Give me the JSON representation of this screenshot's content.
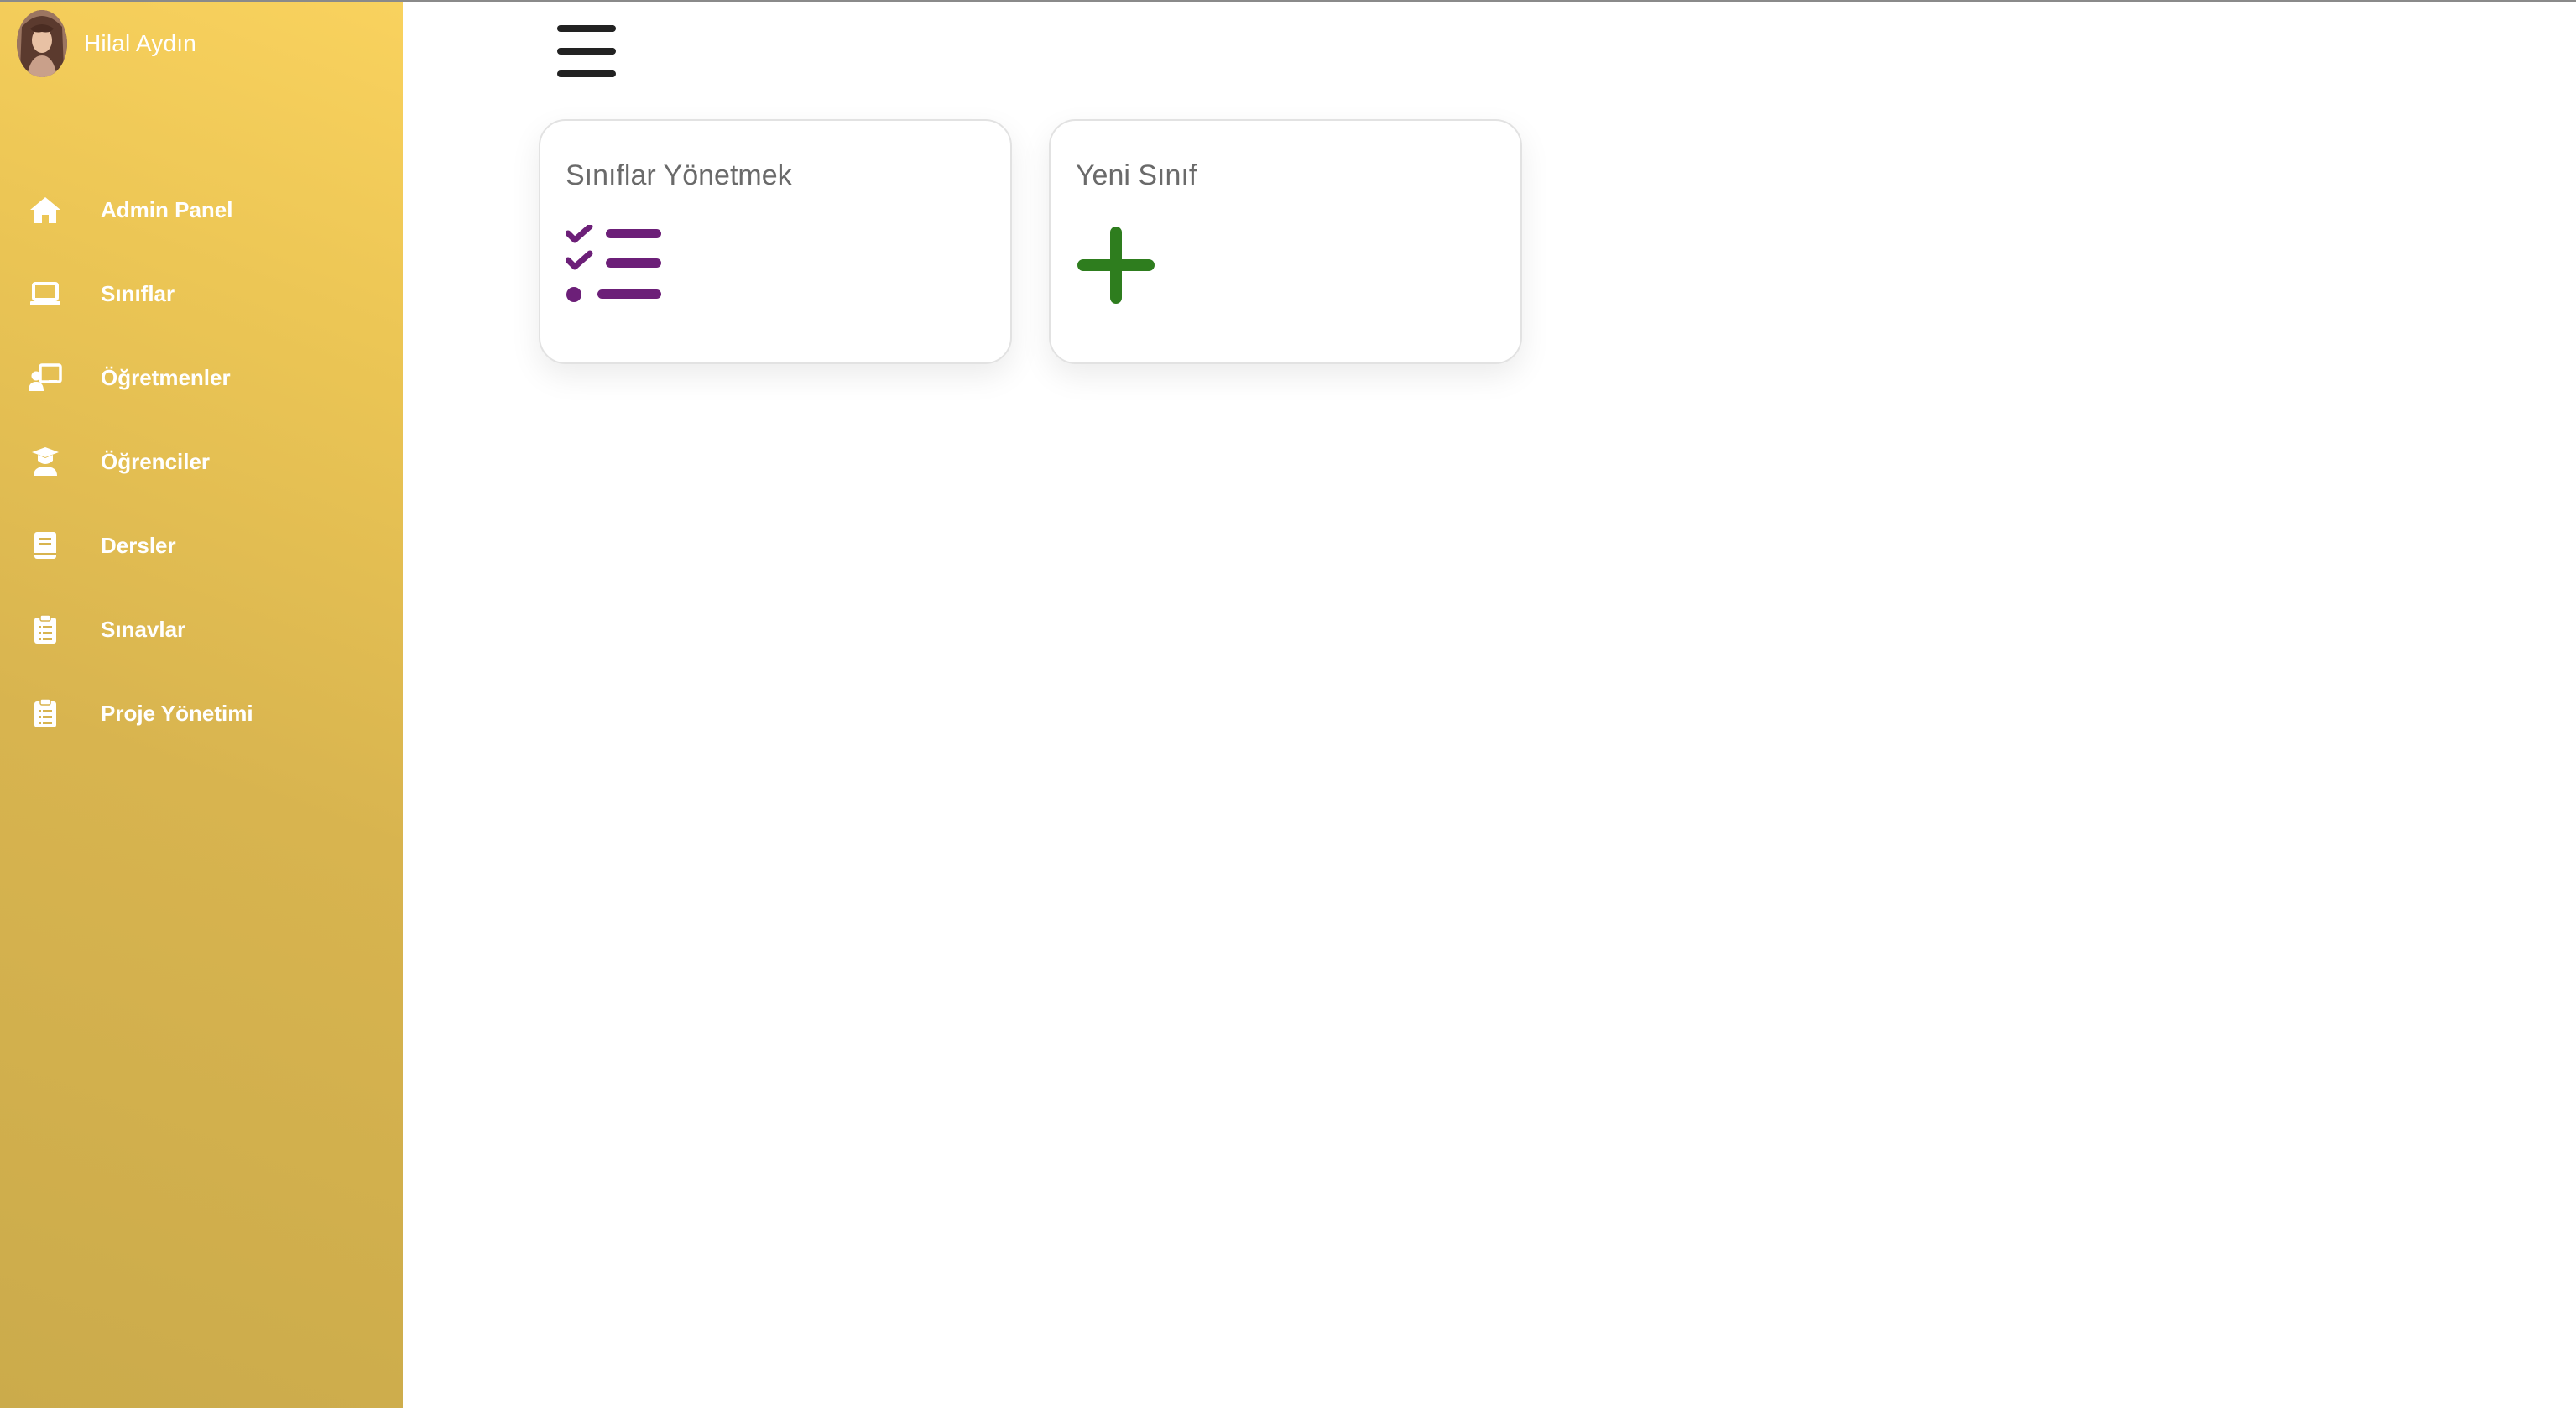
{
  "user": {
    "name": "Hilal Aydın"
  },
  "sidebar": {
    "items": [
      {
        "label": "Admin Panel",
        "icon": "home-icon"
      },
      {
        "label": "Sınıflar",
        "icon": "laptop-icon"
      },
      {
        "label": "Öğretmenler",
        "icon": "teacher-board-icon"
      },
      {
        "label": "Öğrenciler",
        "icon": "graduate-icon"
      },
      {
        "label": "Dersler",
        "icon": "book-icon"
      },
      {
        "label": "Sınavlar",
        "icon": "clipboard-icon"
      },
      {
        "label": "Proje Yönetimi",
        "icon": "clipboard-icon"
      }
    ]
  },
  "header": {
    "menu_icon": "hamburger-menu-icon"
  },
  "cards": [
    {
      "title": "Sınıflar Yönetmek",
      "icon": "checklist-icon",
      "icon_color": "#6c1f78"
    },
    {
      "title": "Yeni Sınıf",
      "icon": "plus-icon",
      "icon_color": "#2e7d1e"
    }
  ],
  "colors": {
    "sidebar_top": "#f9d25e",
    "sidebar_bottom": "#cbab4b",
    "sidebar_text": "#ffffff",
    "card_border": "#e2e2e2"
  }
}
